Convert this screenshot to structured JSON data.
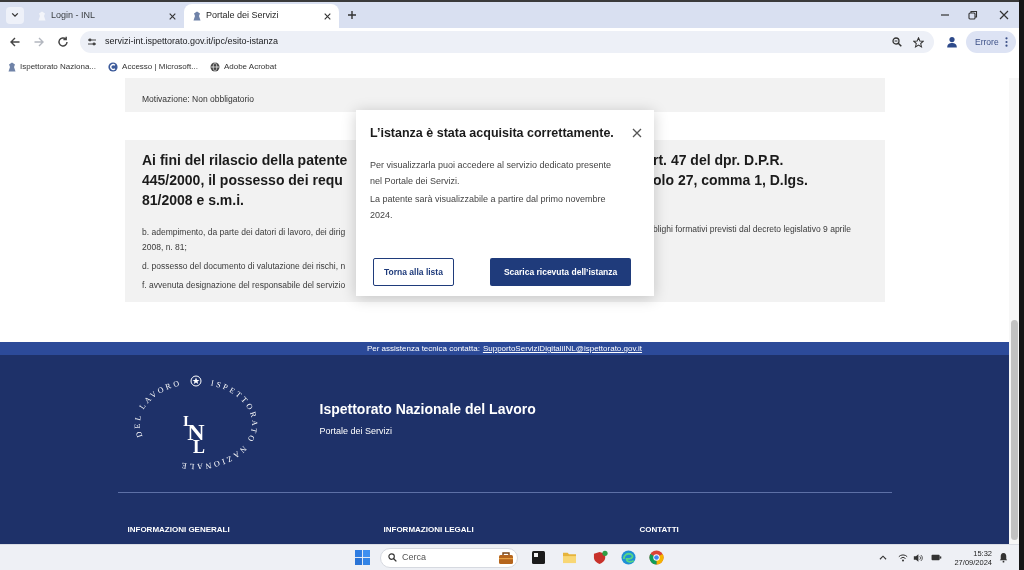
{
  "browser": {
    "tabs": [
      {
        "title": "Login - INL",
        "selected": false
      },
      {
        "title": "Portale dei Servizi",
        "selected": true
      }
    ],
    "nav_buttons": [
      {
        "kind": "back",
        "disabled": false
      },
      {
        "kind": "forward",
        "disabled": true
      },
      {
        "kind": "reload",
        "disabled": false
      }
    ],
    "address": "servizi-int.ispettorato.gov.it/ipc/esito-istanza",
    "profile_button": "Errore",
    "bookmarks": [
      {
        "label": "Ispettorato Naziona...",
        "kind": "crest"
      },
      {
        "label": "Accesso | Microsoft...",
        "kind": "app"
      },
      {
        "label": "Adobe Acrobat",
        "kind": "web"
      }
    ]
  },
  "page": {
    "reason_line": "Motivazione: Non obbligatorio",
    "requirements_card": {
      "heading_lines": [
        {
          "left": "Ai fini del rilascio della patente",
          "right": "rt. 47 del dpr. D.P.R."
        },
        {
          "left": "445/2000, il possesso dei requ",
          "right": "olo 27, comma 1, D.lgs."
        },
        {
          "left": "81/2008 e s.m.i."
        }
      ],
      "items": [
        {
          "lines": [
            {
              "left": "b. adempimento, da parte dei datori di lavoro, dei dirig",
              "right": "blighi formativi previsti dal decreto legislativo 9 aprile"
            },
            {
              "left": "2008, n. 81;"
            }
          ]
        },
        {
          "lines": [
            {
              "left": "d. possesso del documento di valutazione dei rischi, n"
            }
          ]
        },
        {
          "lines": [
            {
              "left": "f. avvenuta designazione del responsabile del servizio"
            }
          ]
        }
      ]
    }
  },
  "dialog": {
    "title": "L’istanza è stata acquisita correttamente.",
    "paragraphs": [
      "Per visualizzarla puoi accedere al servizio dedicato presente nel Portale dei Servizi.",
      "La patente sarà visualizzabile a partire dal primo novembre 2024."
    ],
    "buttons": [
      {
        "label": "Torna alla lista",
        "kind": "outline"
      },
      {
        "label": "Scarica ricevuta dell’istanza",
        "kind": "filled"
      }
    ]
  },
  "footer": {
    "support_text": "Per assistenza tecnica contatta:",
    "support_link": "SupportoServiziDigitaliINL@ispettorato.gov.it",
    "emblem": {
      "ring_text": [
        "DEL LAVORO",
        "ISPETTORATO NAZIONALE"
      ],
      "monogram": [
        "I",
        "N",
        "L"
      ]
    },
    "title": "Ispettorato Nazionale del Lavoro",
    "subtitle": "Portale dei Servizi",
    "column_headings": [
      "INFORMAZIONI GENERALI",
      "INFORMAZIONI LEGALI",
      "CONTATTI"
    ]
  },
  "taskbar": {
    "search_placeholder": "Cerca",
    "time": "15:32",
    "date": "27/09/2024"
  }
}
